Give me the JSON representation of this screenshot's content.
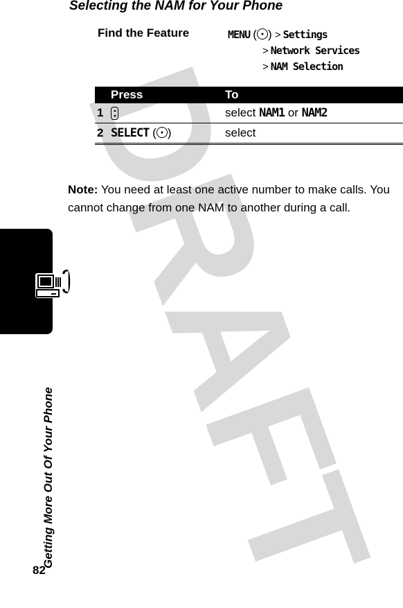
{
  "watermark": "DRAFT",
  "section": {
    "title": "Selecting the NAM for Your Phone"
  },
  "find_feature": {
    "label": "Find the Feature",
    "menu_key": "MENU",
    "menu_key_icon": "center-select-key-icon",
    "path": [
      "Settings",
      "Network Services",
      "NAM Selection"
    ],
    "separator": ">"
  },
  "steps_table": {
    "headers": [
      "",
      "Press",
      "To"
    ],
    "rows": [
      {
        "num": "1",
        "press_icon": "navigation-key-up-down-icon",
        "press_text": "",
        "to_prefix": "select ",
        "to_opt1": "NAM1",
        "to_mid": " or ",
        "to_opt2": "NAM2"
      },
      {
        "num": "2",
        "press_text": "SELECT",
        "press_icon": "center-select-key-icon",
        "to": "select"
      }
    ]
  },
  "note": {
    "label": "Note:",
    "text": " You need at least one active number to make calls. You cannot change from one NAM to another during a call."
  },
  "sidebar": {
    "icon": "computer-phone-icon",
    "chapter_title": "Getting More Out Of Your Phone",
    "page_number": "82"
  }
}
